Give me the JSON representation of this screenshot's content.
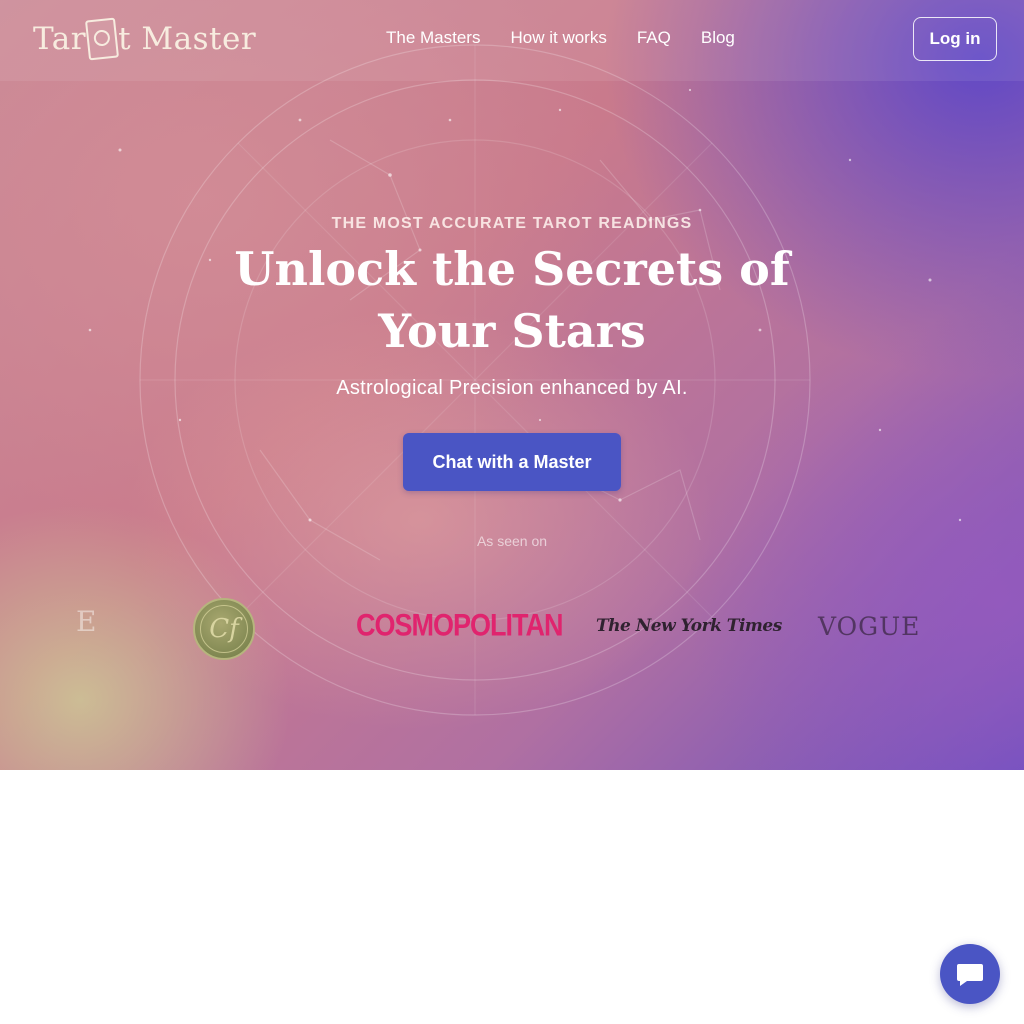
{
  "header": {
    "logo_text_1": "Tar",
    "logo_text_2": "t Master",
    "nav": [
      "The Masters",
      "How it works",
      "FAQ",
      "Blog"
    ],
    "login_label": "Log in"
  },
  "hero": {
    "eyebrow": "THE MOST ACCURATE TAROT READINGS",
    "headline": "Unlock the Secrets of Your Stars",
    "subtitle": "Astrological Precision enhanced by AI.",
    "cta_label": "Chat with a Master",
    "seen_on_label": "As seen on"
  },
  "press": {
    "elle_fragment": "E",
    "seal_monogram": "Cf",
    "cosmopolitan": "COSMOPOLITAN",
    "nyt": "The New York Times",
    "vogue": "VOGUE"
  },
  "colors": {
    "accent": "#4a55c4",
    "cosmopolitan": "#e0246e"
  },
  "icons": {
    "chat_launcher": "chat-bubble-icon"
  }
}
